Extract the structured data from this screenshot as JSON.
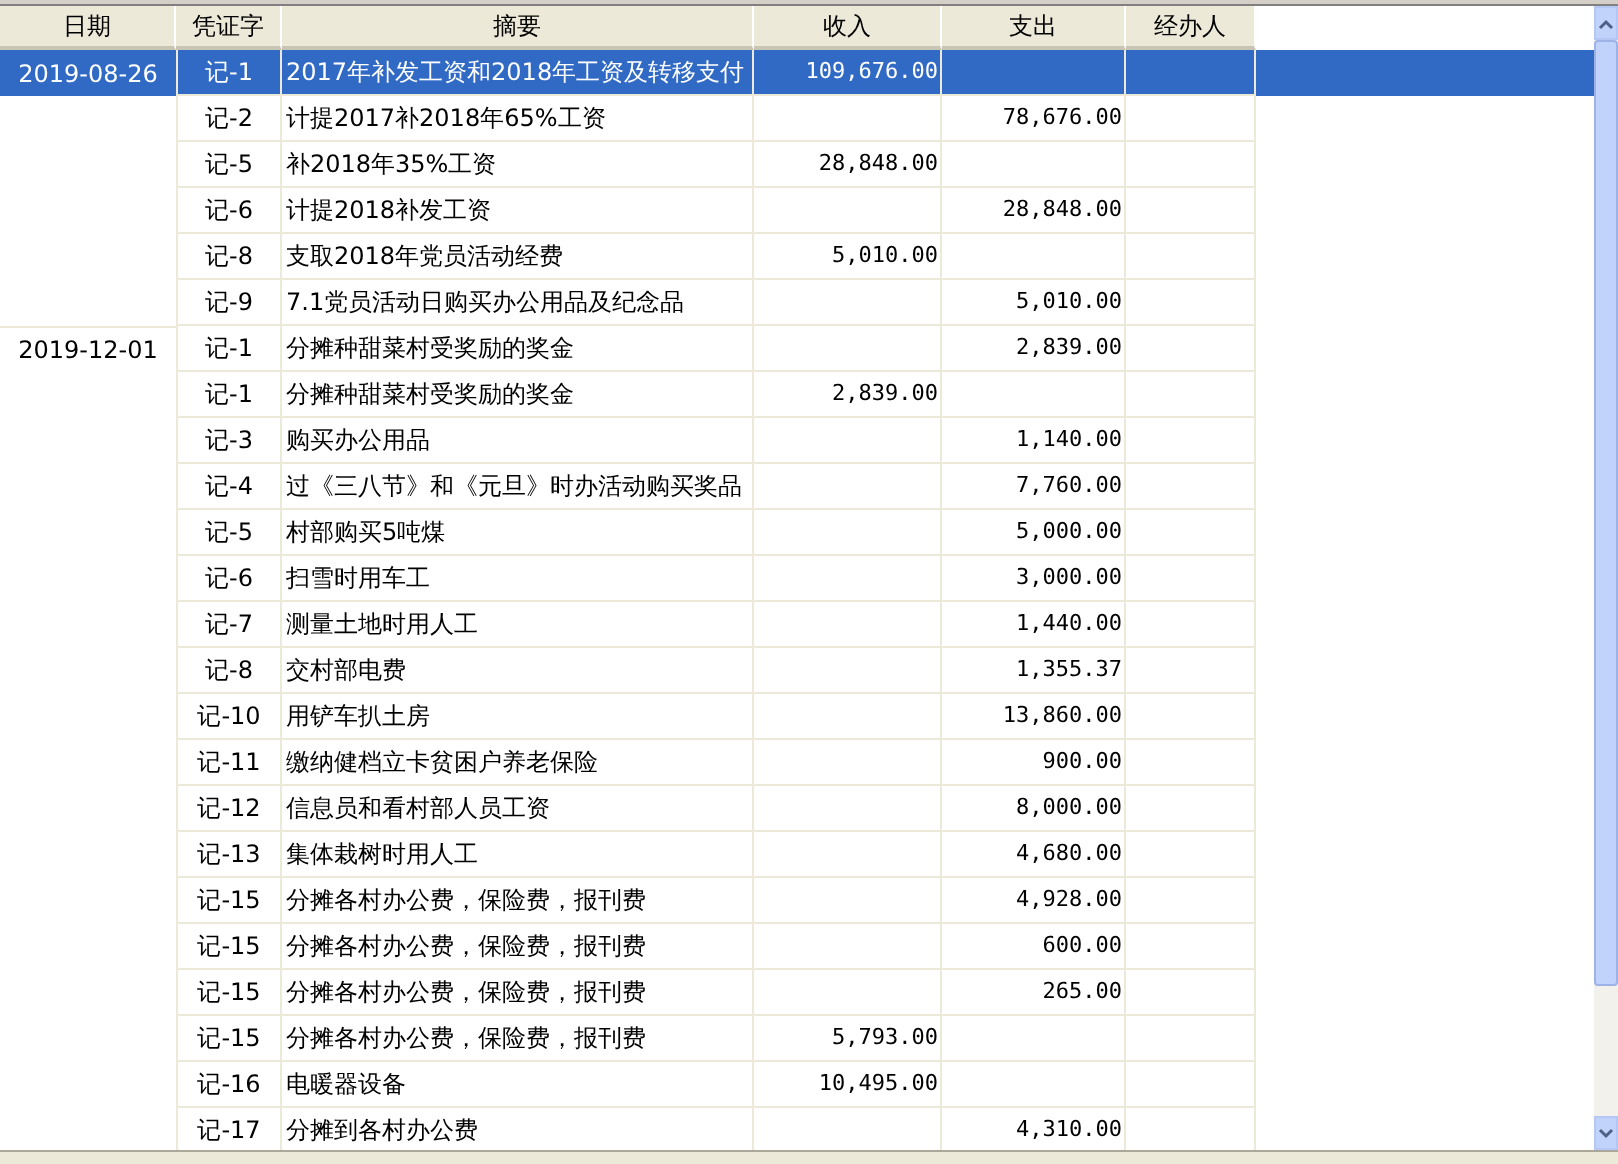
{
  "table": {
    "columns": [
      "日期",
      "凭证字",
      "摘要",
      "收入",
      "支出",
      "经办人"
    ],
    "rows": [
      {
        "date": "2019-08-26",
        "voucher": "记-1",
        "summary": "2017年补发工资和2018年工资及转移支付",
        "income": "109,676.00",
        "selected": true
      },
      {
        "voucher": "记-2",
        "summary": "计提2017补2018年65%工资",
        "expense": "78,676.00",
        "selected": false
      },
      {
        "voucher": "记-5",
        "summary": "补2018年35%工资",
        "income": "28,848.00",
        "selected": false
      },
      {
        "voucher": "记-6",
        "summary": "计提2018补发工资",
        "expense": "28,848.00",
        "selected": false
      },
      {
        "voucher": "记-8",
        "summary": "支取2018年党员活动经费",
        "income": "5,010.00",
        "selected": false
      },
      {
        "voucher": "记-9",
        "summary": "7.1党员活动日购买办公用品及纪念品",
        "expense": "5,010.00",
        "selected": false
      },
      {
        "date": "2019-12-01",
        "voucher": "记-1",
        "summary": "分摊种甜菜村受奖励的奖金",
        "expense": "2,839.00",
        "selected": false
      },
      {
        "voucher": "记-1",
        "summary": "分摊种甜菜村受奖励的奖金",
        "income": "2,839.00",
        "selected": false
      },
      {
        "voucher": "记-3",
        "summary": "购买办公用品",
        "expense": "1,140.00",
        "selected": false
      },
      {
        "voucher": "记-4",
        "summary": "过《三八节》和《元旦》时办活动购买奖品",
        "expense": "7,760.00",
        "selected": false
      },
      {
        "voucher": "记-5",
        "summary": "村部购买5吨煤",
        "expense": "5,000.00",
        "selected": false
      },
      {
        "voucher": "记-6",
        "summary": "扫雪时用车工",
        "expense": "3,000.00",
        "selected": false
      },
      {
        "voucher": "记-7",
        "summary": "测量土地时用人工",
        "expense": "1,440.00",
        "selected": false
      },
      {
        "voucher": "记-8",
        "summary": "交村部电费",
        "expense": "1,355.37",
        "selected": false
      },
      {
        "voucher": "记-10",
        "summary": "用铲车扒土房",
        "expense": "13,860.00",
        "selected": false
      },
      {
        "voucher": "记-11",
        "summary": "缴纳健档立卡贫困户养老保险",
        "expense": "900.00",
        "selected": false
      },
      {
        "voucher": "记-12",
        "summary": "信息员和看村部人员工资",
        "expense": "8,000.00",
        "selected": false
      },
      {
        "voucher": "记-13",
        "summary": "集体栽树时用人工",
        "expense": "4,680.00",
        "selected": false
      },
      {
        "voucher": "记-15",
        "summary": "分摊各村办公费，保险费，报刊费",
        "expense": "4,928.00",
        "selected": false
      },
      {
        "voucher": "记-15",
        "summary": "分摊各村办公费，保险费，报刊费",
        "expense": "600.00",
        "selected": false
      },
      {
        "voucher": "记-15",
        "summary": "分摊各村办公费，保险费，报刊费",
        "expense": "265.00",
        "selected": false
      },
      {
        "voucher": "记-15",
        "summary": "分摊各村办公费，保险费，报刊费",
        "income": "5,793.00",
        "selected": false
      },
      {
        "voucher": "记-16",
        "summary": "电暖器设备",
        "income": "10,495.00",
        "selected": false
      },
      {
        "voucher": "记-17",
        "summary": "分摊到各村办公费",
        "expense": "4,310.00",
        "selected": false
      }
    ]
  }
}
